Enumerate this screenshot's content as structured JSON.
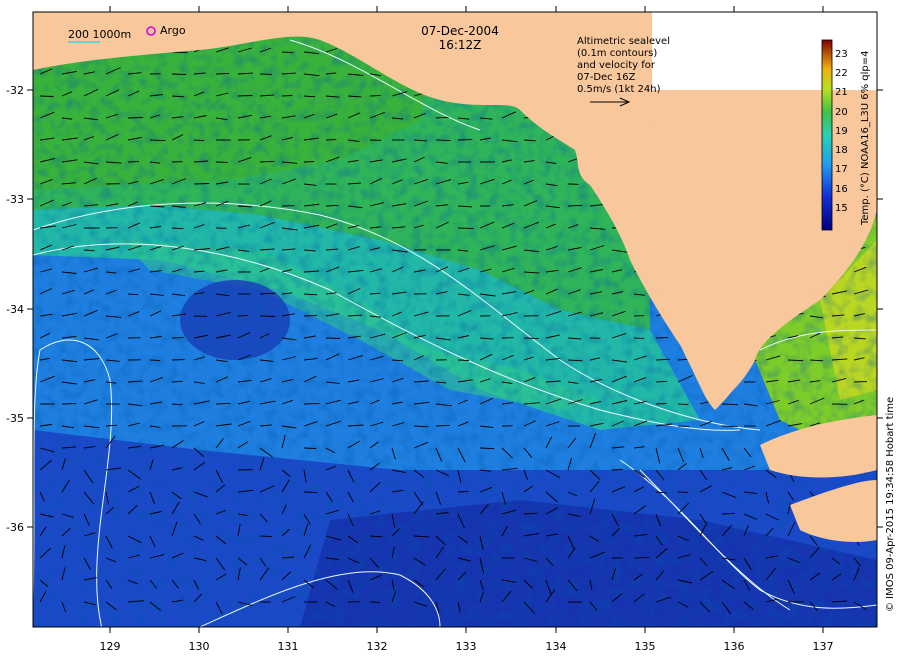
{
  "map": {
    "date": "07-Dec-2004",
    "time": "16:12Z",
    "scale_label": "200  1000m",
    "argo_label": "Argo",
    "note_lines": [
      "Altimetric sealevel",
      "(0.1m contours)",
      "and velocity for",
      "07-Dec 16Z",
      "0.5m/s (1kt 24h)"
    ],
    "colorbar_label": "Temp. (°C) NOAA16_L3U 6% qlp=4",
    "credit": "© IMOS 09-Apr-2015 19:34:58 Hobart time",
    "x_ticks": [
      "129",
      "130",
      "131",
      "132",
      "133",
      "134",
      "135",
      "136",
      "137"
    ],
    "y_ticks": [
      "-32",
      "-33",
      "-34",
      "-35",
      "-36"
    ],
    "colorbar_ticks": [
      "23",
      "22",
      "21",
      "20",
      "19",
      "18",
      "17",
      "16",
      "15"
    ],
    "colors": {
      "land": "#f8c79c",
      "contour": "#e8fbff",
      "arrow": "#000000",
      "argo_marker": "#dd00dd",
      "scale_bar": "#3bd6d6"
    }
  }
}
